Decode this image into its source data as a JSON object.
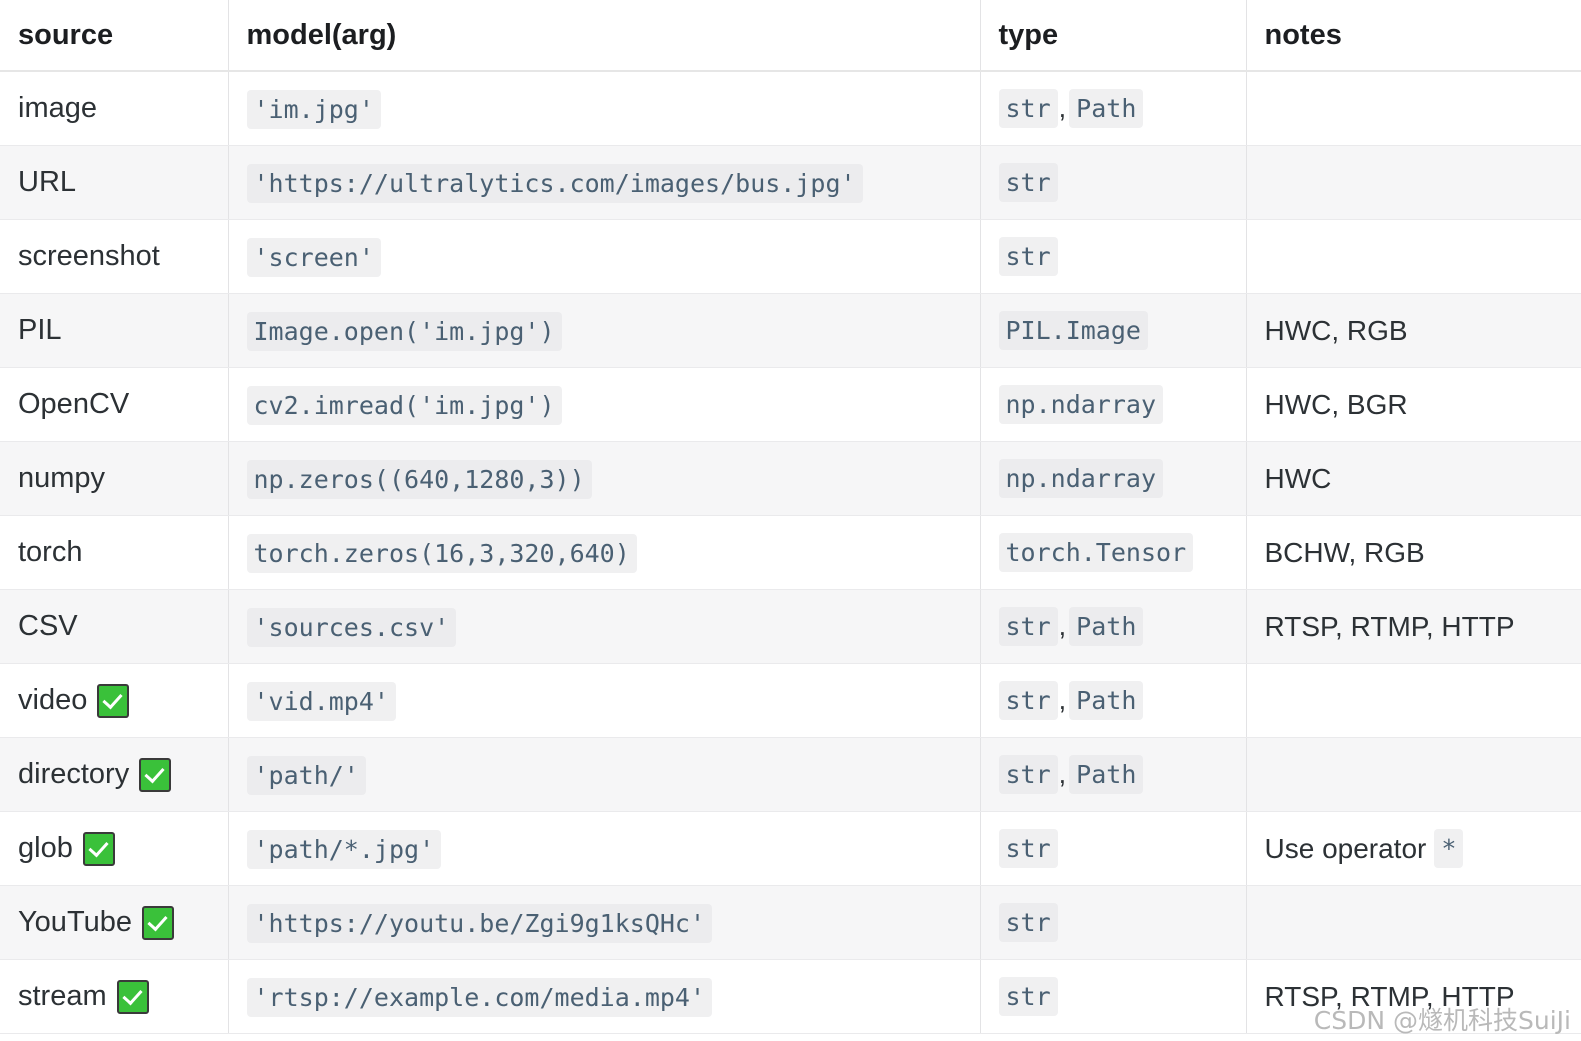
{
  "table": {
    "headers": [
      "source",
      "model(arg)",
      "type",
      "notes"
    ],
    "rows": [
      {
        "source": "image",
        "check": false,
        "model": "'im.jpg'",
        "types": [
          "str",
          "Path"
        ],
        "notes": "",
        "notes_code": ""
      },
      {
        "source": "URL",
        "check": false,
        "model": "'https://ultralytics.com/images/bus.jpg'",
        "types": [
          "str"
        ],
        "notes": "",
        "notes_code": ""
      },
      {
        "source": "screenshot",
        "check": false,
        "model": "'screen'",
        "types": [
          "str"
        ],
        "notes": "",
        "notes_code": ""
      },
      {
        "source": "PIL",
        "check": false,
        "model": "Image.open('im.jpg')",
        "types": [
          "PIL.Image"
        ],
        "notes": "HWC, RGB",
        "notes_code": ""
      },
      {
        "source": "OpenCV",
        "check": false,
        "model": "cv2.imread('im.jpg')",
        "types": [
          "np.ndarray"
        ],
        "notes": "HWC, BGR",
        "notes_code": ""
      },
      {
        "source": "numpy",
        "check": false,
        "model": "np.zeros((640,1280,3))",
        "types": [
          "np.ndarray"
        ],
        "notes": "HWC",
        "notes_code": ""
      },
      {
        "source": "torch",
        "check": false,
        "model": "torch.zeros(16,3,320,640)",
        "types": [
          "torch.Tensor"
        ],
        "notes": "BCHW, RGB",
        "notes_code": ""
      },
      {
        "source": "CSV",
        "check": false,
        "model": "'sources.csv'",
        "types": [
          "str",
          "Path"
        ],
        "notes": "RTSP, RTMP, HTTP",
        "notes_code": ""
      },
      {
        "source": "video",
        "check": true,
        "model": "'vid.mp4'",
        "types": [
          "str",
          "Path"
        ],
        "notes": "",
        "notes_code": ""
      },
      {
        "source": "directory",
        "check": true,
        "model": "'path/'",
        "types": [
          "str",
          "Path"
        ],
        "notes": "",
        "notes_code": ""
      },
      {
        "source": "glob",
        "check": true,
        "model": "'path/*.jpg'",
        "types": [
          "str"
        ],
        "notes": "Use operator",
        "notes_code": "*"
      },
      {
        "source": "YouTube",
        "check": true,
        "model": "'https://youtu.be/Zgi9g1ksQHc'",
        "types": [
          "str"
        ],
        "notes": "",
        "notes_code": ""
      },
      {
        "source": "stream",
        "check": true,
        "model": "'rtsp://example.com/media.mp4'",
        "types": [
          "str"
        ],
        "notes": "RTSP, RTMP, HTTP",
        "notes_code": ""
      }
    ]
  },
  "watermark": "CSDN @燧机科技SuiJi",
  "colors": {
    "check_green": "#3ac13a",
    "chip_bg": "#f0f0f1",
    "chip_text": "#4a6073",
    "alt_row_bg": "#f6f6f7",
    "border": "#eaeaec"
  }
}
